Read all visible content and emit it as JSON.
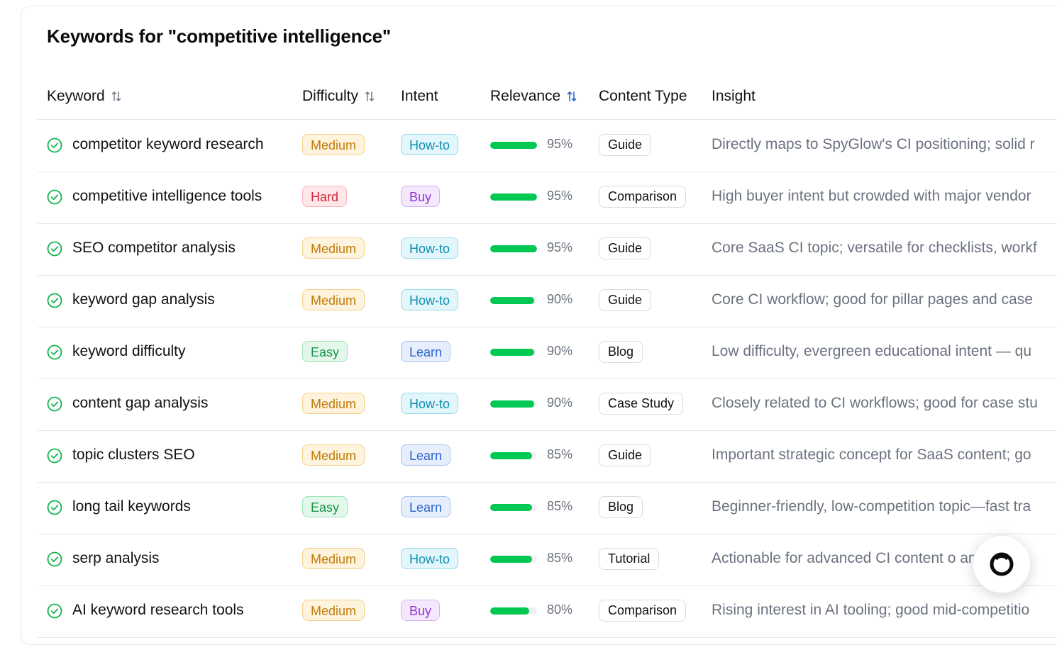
{
  "title": "Keywords for \"competitive intelligence\"",
  "headers": {
    "keyword": "Keyword",
    "difficulty": "Difficulty",
    "intent": "Intent",
    "relevance": "Relevance",
    "content_type": "Content Type",
    "insight": "Insight"
  },
  "colors": {
    "accent_green": "#00c853",
    "sort_active": "#2b63cf"
  },
  "rows": [
    {
      "keyword": "competitor keyword research",
      "difficulty": "Medium",
      "intent": "How-to",
      "relevance": "95%",
      "relevance_value": 0.95,
      "content_type": "Guide",
      "insight": "Directly maps to SpyGlow's CI positioning; solid r"
    },
    {
      "keyword": "competitive intelligence tools",
      "difficulty": "Hard",
      "intent": "Buy",
      "relevance": "95%",
      "relevance_value": 0.95,
      "content_type": "Comparison",
      "insight": "High buyer intent but crowded with major vendor"
    },
    {
      "keyword": "SEO competitor analysis",
      "difficulty": "Medium",
      "intent": "How-to",
      "relevance": "95%",
      "relevance_value": 0.95,
      "content_type": "Guide",
      "insight": "Core SaaS CI topic; versatile for checklists, workf"
    },
    {
      "keyword": "keyword gap analysis",
      "difficulty": "Medium",
      "intent": "How-to",
      "relevance": "90%",
      "relevance_value": 0.9,
      "content_type": "Guide",
      "insight": "Core CI workflow; good for pillar pages and case"
    },
    {
      "keyword": "keyword difficulty",
      "difficulty": "Easy",
      "intent": "Learn",
      "relevance": "90%",
      "relevance_value": 0.9,
      "content_type": "Blog",
      "insight": "Low difficulty, evergreen educational intent — qu"
    },
    {
      "keyword": "content gap analysis",
      "difficulty": "Medium",
      "intent": "How-to",
      "relevance": "90%",
      "relevance_value": 0.9,
      "content_type": "Case Study",
      "insight": "Closely related to CI workflows; good for case stu"
    },
    {
      "keyword": "topic clusters SEO",
      "difficulty": "Medium",
      "intent": "Learn",
      "relevance": "85%",
      "relevance_value": 0.85,
      "content_type": "Guide",
      "insight": "Important strategic concept for SaaS content; go"
    },
    {
      "keyword": "long tail keywords",
      "difficulty": "Easy",
      "intent": "Learn",
      "relevance": "85%",
      "relevance_value": 0.85,
      "content_type": "Blog",
      "insight": "Beginner-friendly, low-competition topic—fast tra"
    },
    {
      "keyword": "serp analysis",
      "difficulty": "Medium",
      "intent": "How-to",
      "relevance": "85%",
      "relevance_value": 0.85,
      "content_type": "Tutorial",
      "insight": "Actionable for advanced CI content o      and"
    },
    {
      "keyword": "AI keyword research tools",
      "difficulty": "Medium",
      "intent": "Buy",
      "relevance": "80%",
      "relevance_value": 0.8,
      "content_type": "Comparison",
      "insight": "Rising interest in AI tooling; good mid-competitio"
    }
  ]
}
